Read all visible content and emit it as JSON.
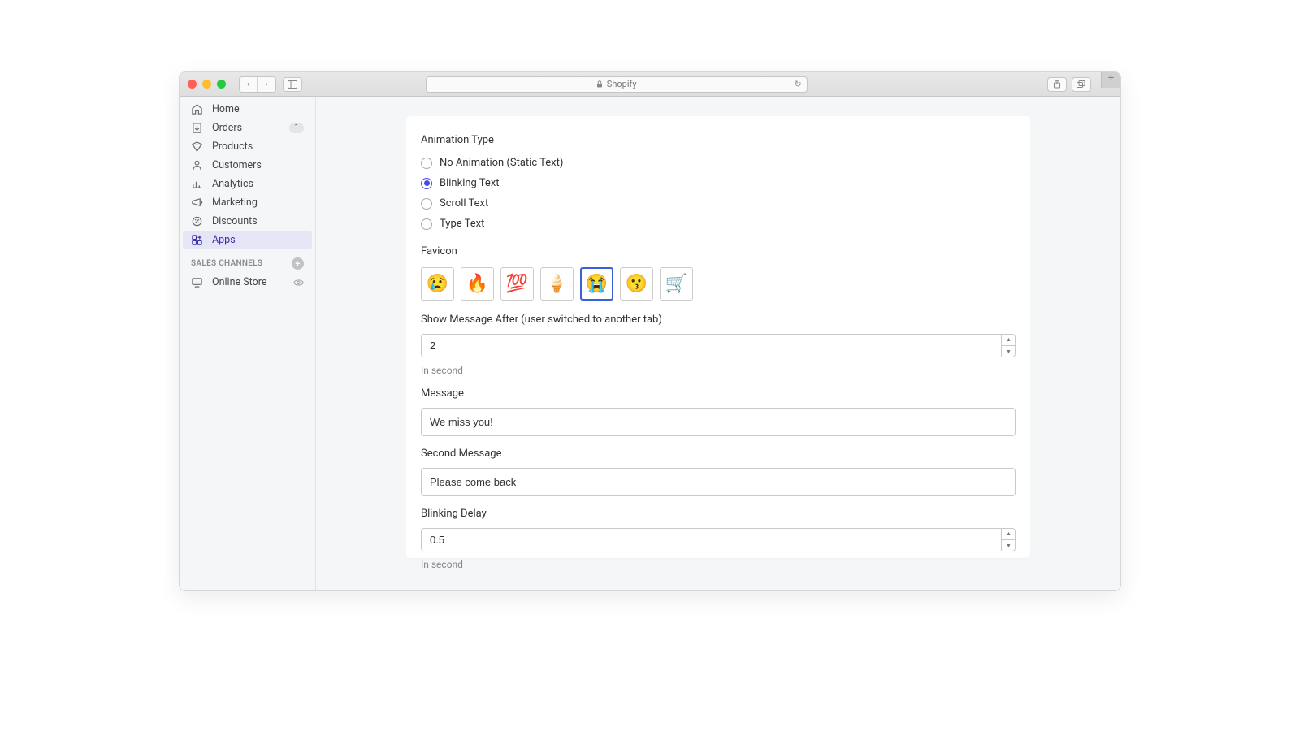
{
  "browser": {
    "title": "Shopify"
  },
  "sidebar": {
    "items": [
      {
        "label": "Home"
      },
      {
        "label": "Orders",
        "badge": "1"
      },
      {
        "label": "Products"
      },
      {
        "label": "Customers"
      },
      {
        "label": "Analytics"
      },
      {
        "label": "Marketing"
      },
      {
        "label": "Discounts"
      },
      {
        "label": "Apps"
      }
    ],
    "sales_channels_heading": "SALES CHANNELS",
    "online_store": "Online Store"
  },
  "form": {
    "animation_type_label": "Animation Type",
    "radios": {
      "none": "No Animation (Static Text)",
      "blinking": "Blinking Text",
      "scroll": "Scroll Text",
      "type": "Type Text"
    },
    "favicon_label": "Favicon",
    "favicons": [
      "😢",
      "🔥",
      "💯",
      "🍦",
      "😭",
      "😗",
      "🛒"
    ],
    "show_after_label": "Show Message After (user switched to another tab)",
    "show_after_value": "2",
    "in_second": "In second",
    "message_label": "Message",
    "message_value": "We miss you!",
    "second_message_label": "Second Message",
    "second_message_value": "Please come back",
    "blinking_delay_label": "Blinking Delay",
    "blinking_delay_value": "0.5"
  }
}
